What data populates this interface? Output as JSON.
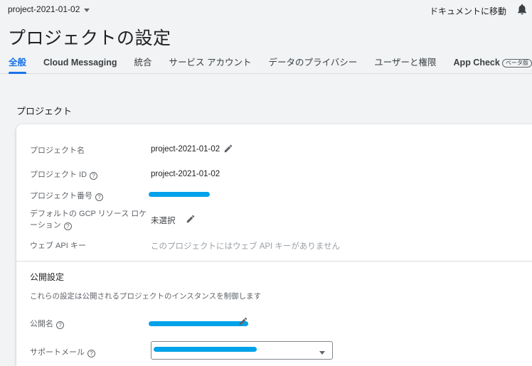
{
  "header": {
    "project_switcher": "project-2021-01-02",
    "docs_link": "ドキュメントに移動",
    "page_title": "プロジェクトの設定"
  },
  "tabs": [
    {
      "label": "全般"
    },
    {
      "label": "Cloud Messaging"
    },
    {
      "label": "統合"
    },
    {
      "label": "サービス アカウント"
    },
    {
      "label": "データのプライバシー"
    },
    {
      "label": "ユーザーと権限"
    },
    {
      "label": "App Check",
      "badge": "ベータ版"
    }
  ],
  "project_section": {
    "title": "プロジェクト",
    "rows": {
      "name_label": "プロジェクト名",
      "name_value": "project-2021-01-02",
      "id_label": "プロジェクト ID",
      "id_value": "project-2021-01-02",
      "number_label": "プロジェクト番号",
      "gcp_label_line1": "デフォルトの GCP リソース ロケ",
      "gcp_label_line2": "ーション",
      "gcp_value": "未選択",
      "webapi_label": "ウェブ API キー",
      "webapi_value": "このプロジェクトにはウェブ API キーがありません"
    }
  },
  "public_section": {
    "title": "公開設定",
    "description": "これらの設定は公開されるプロジェクトのインスタンスを制御します",
    "public_name_label": "公開名",
    "support_email_label": "サポートメール"
  },
  "colors": {
    "accent": "#1a73e8",
    "redaction": "#00a2ea"
  }
}
